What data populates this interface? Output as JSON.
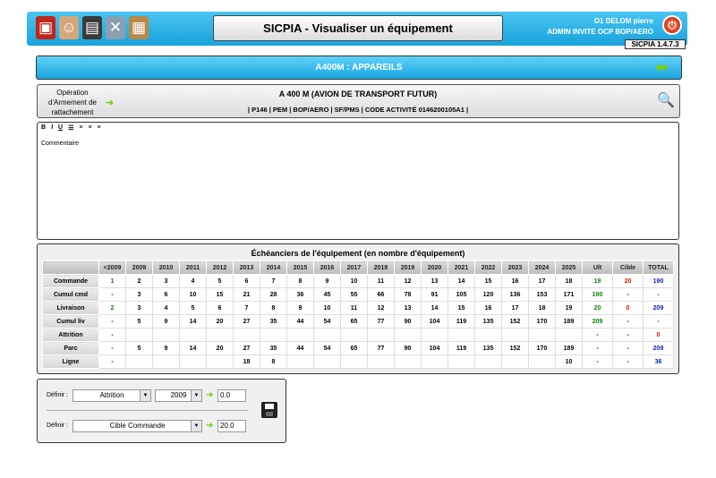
{
  "header": {
    "title": "SICPIA - Visualiser un équipement",
    "user_name": "O1 DELOM pierre",
    "user_role": "ADMIN INVITE OCP BOP/AERO",
    "version": "SICPIA 1.4.7.3",
    "apps": [
      "pdf-app-icon",
      "users-app-icon",
      "film-app-icon",
      "tools-app-icon",
      "box-app-icon"
    ],
    "accent": "#1aa3dd"
  },
  "section": {
    "title": "A400M : APPAREILS"
  },
  "operation": {
    "label": "Opération d'Armement de rattachement",
    "name": "A 400 M (AVION DE TRANSPORT FUTUR)",
    "codes": "| P146 | PEM | BOP/AERO | SF/PMS | CODE ACTIVITÉ 0146200105A1 |"
  },
  "editor": {
    "toolbar": [
      "B",
      "I",
      "U",
      "☰",
      "≡",
      "≡",
      "≡"
    ],
    "text": "Commentaire"
  },
  "echeancier": {
    "title": "Échéanciers de l'équipement (en nombre d'équipement)",
    "columns": [
      "<2009",
      "2009",
      "2010",
      "2011",
      "2012",
      "2013",
      "2014",
      "2015",
      "2016",
      "2017",
      "2018",
      "2019",
      "2020",
      "2021",
      "2022",
      "2023",
      "2024",
      "2025",
      "Ult",
      "Cible",
      "TOTAL"
    ],
    "rows": [
      {
        "label": "Commande",
        "cells": [
          "1",
          "2",
          "3",
          "4",
          "5",
          "6",
          "7",
          "8",
          "9",
          "10",
          "11",
          "12",
          "13",
          "14",
          "15",
          "16",
          "17",
          "18",
          "19",
          "20",
          "190"
        ]
      },
      {
        "label": "Cumul cmd",
        "cells": [
          "-",
          "3",
          "6",
          "10",
          "15",
          "21",
          "28",
          "36",
          "45",
          "55",
          "66",
          "78",
          "91",
          "105",
          "120",
          "136",
          "153",
          "171",
          "190",
          "-",
          "-"
        ]
      },
      {
        "label": "Livraison",
        "cells": [
          "2",
          "3",
          "4",
          "5",
          "6",
          "7",
          "8",
          "9",
          "10",
          "11",
          "12",
          "13",
          "14",
          "15",
          "16",
          "17",
          "18",
          "19",
          "20",
          "0",
          "209"
        ]
      },
      {
        "label": "Cumul liv",
        "cells": [
          "-",
          "5",
          "9",
          "14",
          "20",
          "27",
          "35",
          "44",
          "54",
          "65",
          "77",
          "90",
          "104",
          "119",
          "135",
          "152",
          "170",
          "189",
          "209",
          "-",
          "-"
        ]
      },
      {
        "label": "Attrition",
        "cells": [
          "-",
          "",
          "",
          "",
          "",
          "",
          "",
          "",
          "",
          "",
          "",
          "",
          "",
          "",
          "",
          "",
          "",
          "",
          "-",
          "-",
          "0"
        ]
      },
      {
        "label": "Parc",
        "cells": [
          "-",
          "5",
          "9",
          "14",
          "20",
          "27",
          "35",
          "44",
          "54",
          "65",
          "77",
          "90",
          "104",
          "119",
          "135",
          "152",
          "170",
          "189",
          "-",
          "-",
          "209"
        ]
      },
      {
        "label": "Ligne",
        "cells": [
          "-",
          "",
          "",
          "",
          "",
          "18",
          "8",
          "",
          "",
          "",
          "",
          "",
          "",
          "",
          "",
          "",
          "",
          "10",
          "-",
          "-",
          "36"
        ]
      }
    ]
  },
  "define": {
    "label": "Définir :",
    "row1": {
      "type": "Attrition",
      "year": "2009",
      "value": "0.0"
    },
    "row2": {
      "type": "Cible Commande",
      "value": "20.0"
    }
  }
}
